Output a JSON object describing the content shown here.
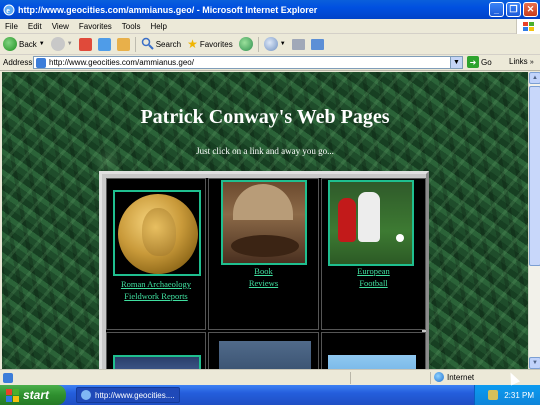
{
  "window": {
    "title": "http://www.geocities.com/ammianus.geo/ - Microsoft Internet Explorer",
    "minimize": "_",
    "restore": "❐",
    "close": "✕"
  },
  "menu": [
    "File",
    "Edit",
    "View",
    "Favorites",
    "Tools",
    "Help"
  ],
  "toolbar": {
    "back": "Back",
    "search": "Search",
    "favorites": "Favorites"
  },
  "address": {
    "label": "Address",
    "url": "http://www.geocities.com/ammianus.geo/",
    "go": "Go",
    "links": "Links"
  },
  "page": {
    "title": "Patrick Conway's Web Pages",
    "subtitle": "Just click on a link and away you go...",
    "links": [
      {
        "line1": "Roman Archaeology",
        "line2": "Fieldwork Reports"
      },
      {
        "line1": "Book",
        "line2": "Reviews"
      },
      {
        "line1": "European",
        "line2": "Football"
      }
    ]
  },
  "status": {
    "zone": "Internet"
  },
  "taskbar": {
    "start": "start",
    "task": "http://www.geocities....",
    "clock": "2:31 PM"
  }
}
